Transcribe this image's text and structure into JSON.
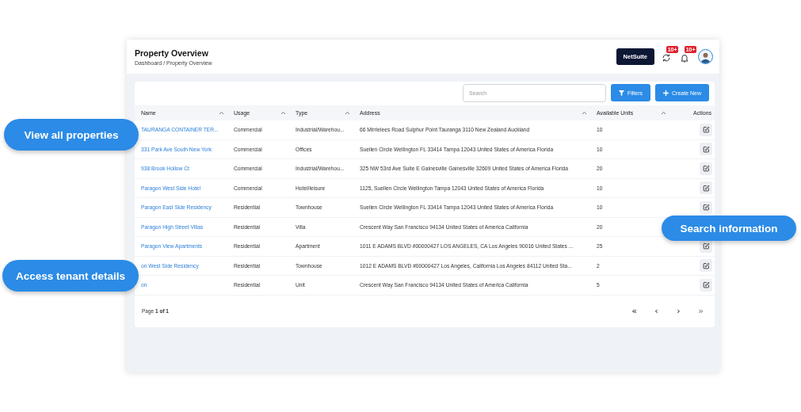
{
  "header": {
    "title": "Property Overview",
    "breadcrumb": "Dashboard / Property Overview",
    "netsuite_button": "NetSuite",
    "notifications": [
      {
        "kind": "sync",
        "badge": "10+"
      },
      {
        "kind": "bell",
        "badge": "10+"
      }
    ]
  },
  "toolbar": {
    "search": {
      "placeholder": "Search"
    },
    "filters_button": "Filters",
    "create_button": "Create New"
  },
  "table": {
    "columns": [
      {
        "label": "Name",
        "sortable": true
      },
      {
        "label": "Usage",
        "sortable": true
      },
      {
        "label": "Type",
        "sortable": true
      },
      {
        "label": "Address",
        "sortable": true
      },
      {
        "label": "Available Units",
        "sortable": true
      },
      {
        "label": "Actions",
        "sortable": false
      }
    ],
    "rows": [
      {
        "name": "TAURANGA CONTAINER TER...",
        "usage": "Commercial",
        "type": "Industrial/Warehou...",
        "address": "66 Mirrielees Road Sulphur Point Tauranga 3110 New Zealand Auckland",
        "units": "10",
        "edit_visible": true
      },
      {
        "name": "331 Park Ave South New York",
        "usage": "Commercial",
        "type": "Offices",
        "address": "Suellen Circle Wellington FL 33414 Tampa 12043 United States of America Florida",
        "units": "10",
        "edit_visible": true
      },
      {
        "name": "938 Brook Hollow Ct",
        "usage": "Commercial",
        "type": "Industrial/Warehou...",
        "address": "325 NW 53rd Ave Suite E Gainesville Gainesville 32609 United States of America Florida",
        "units": "20",
        "edit_visible": true
      },
      {
        "name": "Paragon West Side Hotel",
        "usage": "Commercial",
        "type": "Hotel/leisure",
        "address": "1125, Suellen Circle Wellington Tampa 12043 United States of America Florida",
        "units": "10",
        "edit_visible": true
      },
      {
        "name": "Paragon East Side Residency",
        "usage": "Residential",
        "type": "Townhouse",
        "address": "Suellen Circle Wellington FL 33414 Tampa 12043 United States of America Florida",
        "units": "10",
        "edit_visible": true
      },
      {
        "name": "Paragon High Street Villas",
        "usage": "Residential",
        "type": "Villa",
        "address": "Crescent Way San Francisco 94134 United States of America California",
        "units": "20",
        "edit_visible": false
      },
      {
        "name": "Paragon View Apartments",
        "usage": "Residential",
        "type": "Apartment",
        "address": "1011 E ADAMS BLVD #00000427 LOS ANGELES, CA Los Angeles 90016 United States ...",
        "units": "25",
        "edit_visible": true
      },
      {
        "name": "on West Side Residency",
        "usage": "Residential",
        "type": "Townhouse",
        "address": "1012 E ADAMS BLVD #00000427 Los Angeles, California Los Angeles 84112 United Sta...",
        "units": "2",
        "edit_visible": true
      },
      {
        "name": "on",
        "usage": "Residential",
        "type": "Unit",
        "address": "Crescent Way San Francisco 94134 United States of America California",
        "units": "5",
        "edit_visible": true
      }
    ]
  },
  "pagination": {
    "label": "Page **1 of 1**",
    "buttons": [
      {
        "symbol": "«",
        "disabled": false
      },
      {
        "symbol": "‹",
        "disabled": false
      },
      {
        "symbol": "›",
        "disabled": false
      },
      {
        "symbol": "»",
        "disabled": true
      }
    ]
  },
  "callouts": [
    {
      "text": "View all properties"
    },
    {
      "text": "Search information"
    },
    {
      "text": "Access tenant details"
    }
  ]
}
